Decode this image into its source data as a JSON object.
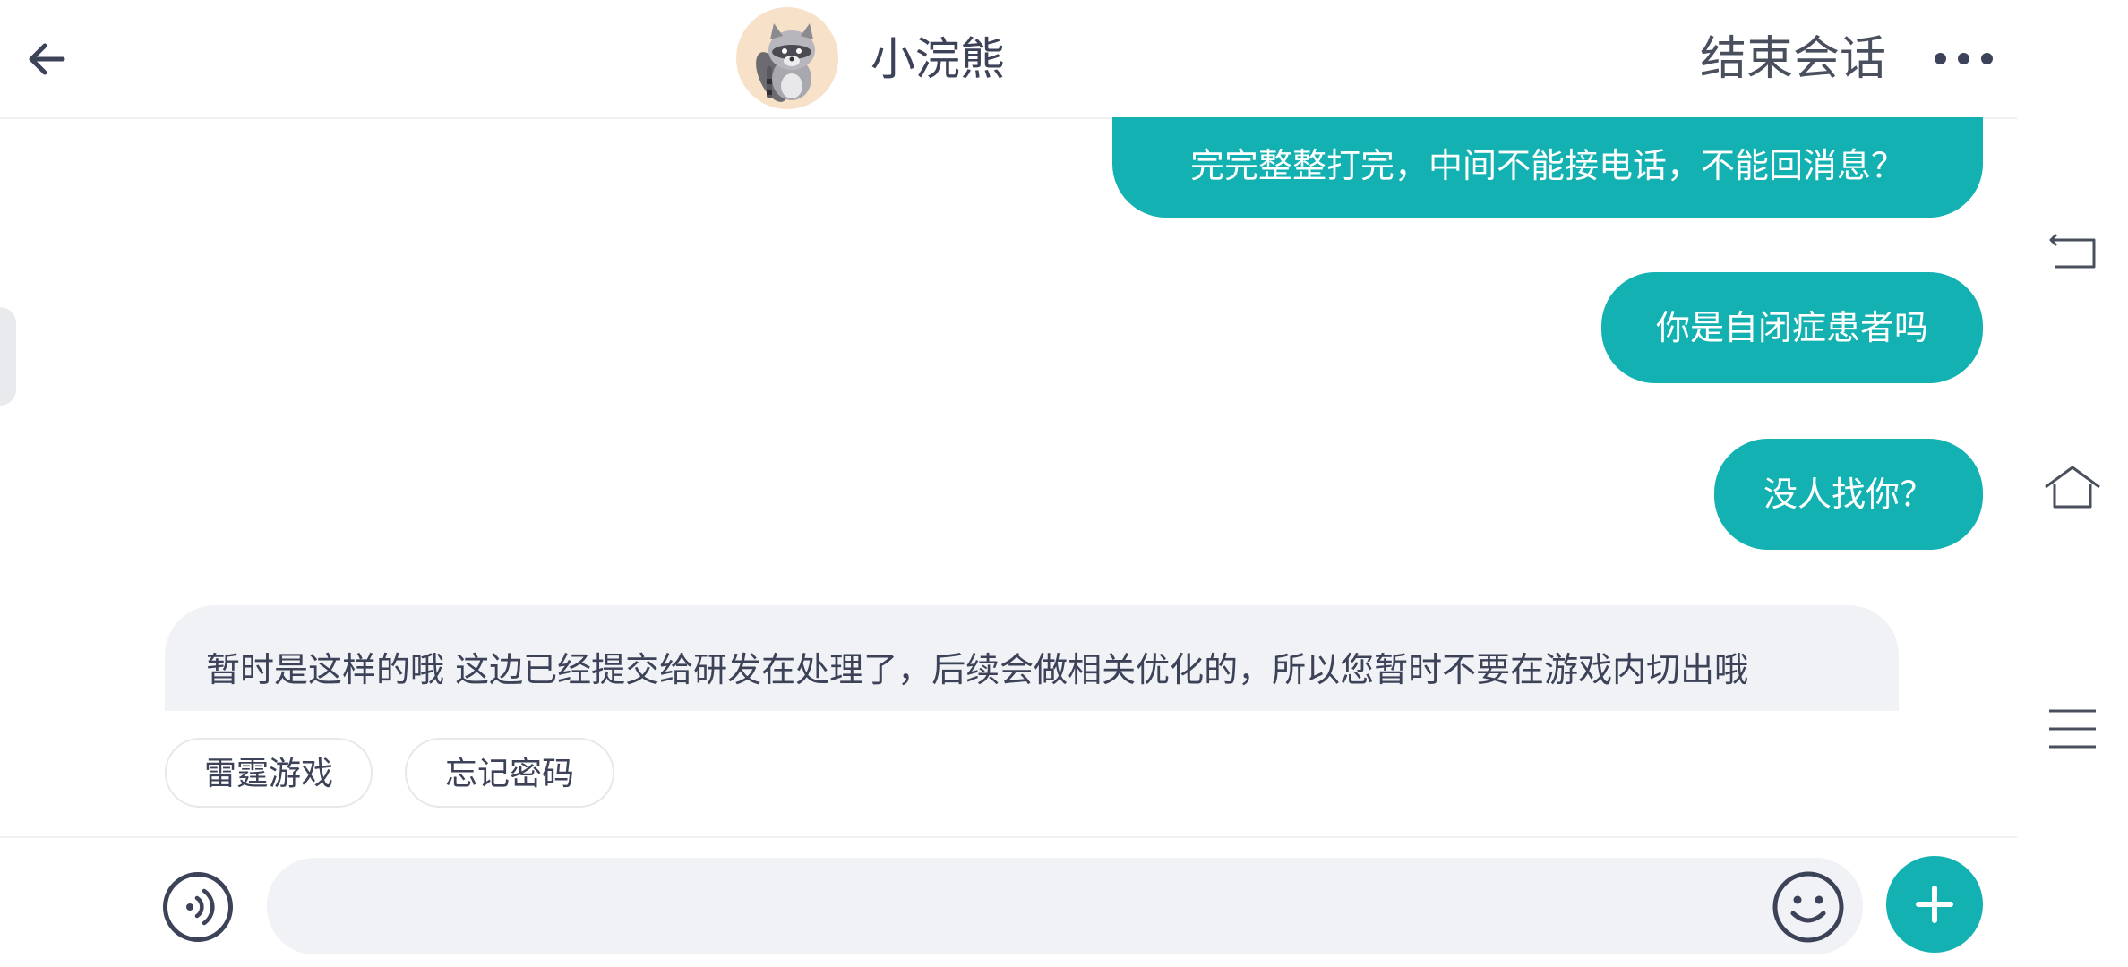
{
  "header": {
    "back_icon": "back-arrow-icon",
    "avatar_icon": "raccoon-avatar",
    "title": "小浣熊",
    "end_session_label": "结束会话",
    "more_icon": "more-dots-icon"
  },
  "messages": {
    "sent": [
      {
        "text": "完完整整打完，中间不能接电话，不能回消息？"
      },
      {
        "text": "你是自闭症患者吗"
      },
      {
        "text": "没人找你？"
      }
    ],
    "received": [
      {
        "text": "暂时是这样的哦 这边已经提交给研发在处理了，后续会做相关优化的，所以您暂时不要在游戏内切出哦"
      }
    ]
  },
  "quick_replies": [
    {
      "label": "雷霆游戏"
    },
    {
      "label": "忘记密码"
    }
  ],
  "input": {
    "placeholder": "",
    "voice_icon": "voice-icon",
    "emoji_icon": "emoji-icon",
    "plus_icon": "plus-icon"
  },
  "system_nav": [
    "back-nav-icon",
    "home-nav-icon",
    "menu-nav-icon"
  ],
  "colors": {
    "accent": "#13b1b1",
    "text": "#3c4257",
    "bubble_in": "#f0f2f6"
  }
}
